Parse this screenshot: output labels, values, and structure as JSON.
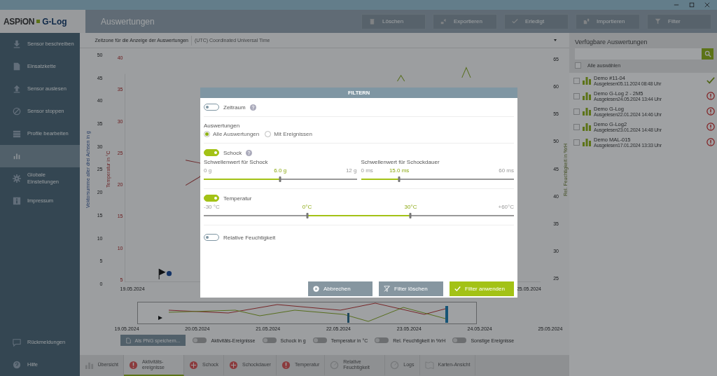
{
  "app": {
    "logo_left": "ASPiON",
    "logo_right": "G-Log",
    "title": "Auswertungen"
  },
  "toolbar": [
    {
      "label": "Löschen",
      "kind": "delete"
    },
    {
      "label": "Exportieren",
      "kind": "export"
    },
    {
      "label": "Erledigt",
      "kind": "done"
    },
    {
      "label": "Importieren",
      "kind": "import"
    },
    {
      "label": "Filter",
      "kind": "filter"
    }
  ],
  "sidebar": {
    "items": [
      {
        "label": "Sensor beschreiben",
        "kind": "download",
        "selected": false
      },
      {
        "label": "Einsatzkette",
        "kind": "doc",
        "selected": false
      },
      {
        "label": "Sensor auslesen",
        "kind": "upload",
        "selected": false
      },
      {
        "label": "Sensor stoppen",
        "kind": "stop",
        "selected": false
      },
      {
        "label": "Profile bearbeiten",
        "kind": "profile",
        "selected": false
      },
      {
        "kind": "chart",
        "selected": true
      },
      {
        "label": "Globale Einstellungen",
        "kind": "gear",
        "selected": false
      },
      {
        "label": "Impressum",
        "kind": "info",
        "selected": false
      }
    ],
    "bottom": [
      {
        "label": "Rückmeldungen",
        "kind": "chat"
      },
      {
        "label": "Hilfe",
        "kind": "help"
      }
    ]
  },
  "timezone": {
    "label": "Zeitzone für die Anzeige der Auswertungen",
    "value": "(UTC) Coordinated Universal Time"
  },
  "chart": {
    "left_axis_label": "Vektorsumme aller drei Achsen in g",
    "left_ticks": [
      "50",
      "45",
      "40",
      "35",
      "30",
      "25",
      "20",
      "15",
      "10",
      "5",
      "0"
    ],
    "temp_axis_label": "Temperatur in °C",
    "temp_ticks": [
      "40",
      "35",
      "30",
      "25",
      "20",
      "15",
      "10",
      "5"
    ],
    "right_axis_label": "Rel. Feuchtigkeit in %rH",
    "right_ticks": [
      "65",
      "60",
      "55",
      "50",
      "45",
      "40",
      "35",
      "30",
      "25"
    ],
    "x_dates": [
      "19.05.2024",
      "25.05.2024"
    ]
  },
  "overview": {
    "dates": [
      "19.05.2024",
      "20.05.2024",
      "21.05.2024",
      "22.05.2024",
      "23.05.2024",
      "24.05.2024",
      "25.05.2024"
    ]
  },
  "legend": {
    "save_button": "Als PNG speichern...",
    "toggles": [
      {
        "label": "Aktivitäts-Ereignisse",
        "on": false
      },
      {
        "label": "Schock in g",
        "on": false
      },
      {
        "label": "Temperatur in °C",
        "on": false
      },
      {
        "label": "Rel. Feuchtigkeit in %rH",
        "on": false
      },
      {
        "label": "Sonstige Ereignisse",
        "on": false
      }
    ]
  },
  "bottom_tabs": [
    {
      "label": "Übersicht",
      "kind": "bars",
      "selected": false
    },
    {
      "label": "Aktivitäts-ereignisse",
      "kind": "multi",
      "selected": true
    },
    {
      "label": "Schock",
      "kind": "shock",
      "selected": false
    },
    {
      "label": "Schockdauer",
      "kind": "shockdur",
      "selected": false
    },
    {
      "label": "Temperatur",
      "kind": "temp",
      "selected": false
    },
    {
      "label": "Relative Feuchtigkeit",
      "kind": "humid",
      "selected": false
    },
    {
      "label": "Logs",
      "kind": "logs",
      "selected": false
    },
    {
      "label": "Karten-Ansicht",
      "kind": "map",
      "selected": false
    }
  ],
  "panel": {
    "title": "Verfügbare Auswertungen",
    "select_all": {
      "label": "Alle auswählen",
      "checked": false
    },
    "items": [
      {
        "name": "Demo #11-04",
        "read": "Ausgelesen05.11.2024 08:48 Uhr",
        "checked": false,
        "kind": "ok"
      },
      {
        "name": "Demo G-Log 2 - 2M5",
        "read": "Ausgelesen24.05.2024 13:44 Uhr",
        "checked": false,
        "kind": "error"
      },
      {
        "name": "Demo G-Log",
        "read": "Ausgelesen22.01.2024 14:46 Uhr",
        "checked": false,
        "kind": "error"
      },
      {
        "name": "Demo G-Log2",
        "read": "Ausgelesen23.01.2024 14:48 Uhr",
        "checked": false,
        "kind": "error"
      },
      {
        "name": "Demo MAL-015",
        "read": "Ausgelesen17.01.2024 13:33 Uhr",
        "checked": false,
        "kind": "error"
      }
    ]
  },
  "dialog": {
    "title": "FILTERN",
    "period": {
      "label": "Zeitraum",
      "on": false
    },
    "evaluations": {
      "label": "Auswertungen",
      "options": [
        {
          "label": "Alle Auswertungen",
          "selected": true
        },
        {
          "label": "Mit Ereignissen",
          "selected": false
        }
      ]
    },
    "shock": {
      "label": "Schock",
      "on": true,
      "sliders": [
        {
          "label": "Schwellenwert für Schock",
          "min": "0 g",
          "max": "12 g",
          "value": "6.0 g",
          "level": 0.5
        },
        {
          "label": "Schwellenwert für Schockdauer",
          "min": "0 ms",
          "max": "60 ms",
          "value": "15.0 ms",
          "level": 0.25
        }
      ]
    },
    "temperature": {
      "label": "Temperatur",
      "on": true,
      "min": "-30 °C",
      "max": "+60°C",
      "thumbs": [
        {
          "label": "0°C",
          "level": 0.333
        },
        {
          "label": "30°C",
          "level": 0.667
        }
      ]
    },
    "humidity": {
      "label": "Relative Feuchtigkeit",
      "on": false
    },
    "buttons": [
      {
        "label": "Abbrechen",
        "kind": "cancel"
      },
      {
        "label": "Filter löschen",
        "kind": "clear"
      },
      {
        "label": "Filter anwenden",
        "kind": "apply"
      }
    ]
  }
}
